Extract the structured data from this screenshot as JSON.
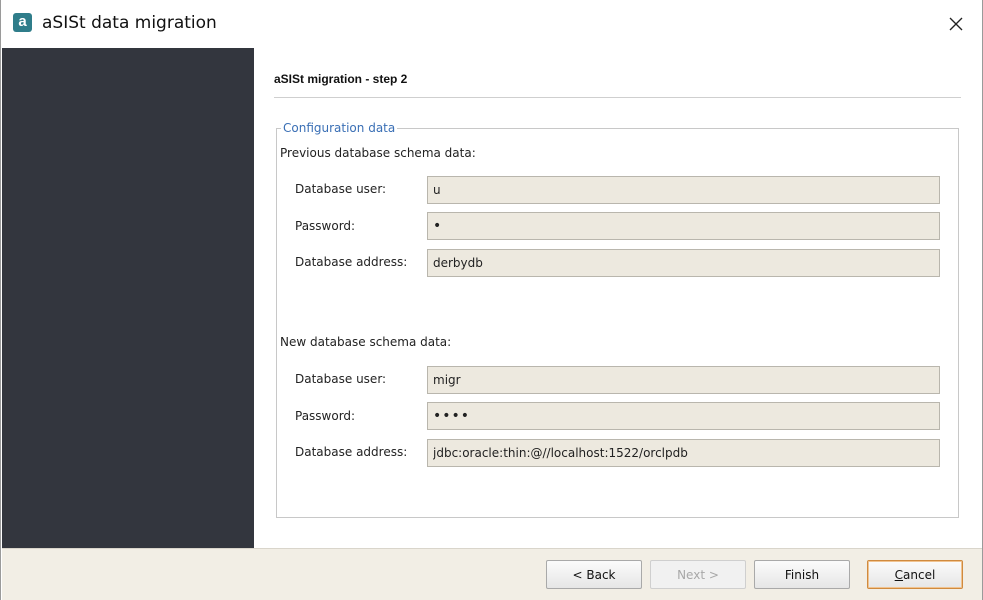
{
  "window": {
    "title": "aSISt data migration",
    "app_icon_letter": "a",
    "close_glyph": "✕"
  },
  "wizard": {
    "step_title": "aSISt migration - step 2"
  },
  "config": {
    "legend": "Configuration data",
    "previous": {
      "heading": "Previous database schema data:",
      "user_label": "Database user:",
      "user_value": "u",
      "password_label": "Password:",
      "password_value": "•",
      "address_label": "Database address:",
      "address_value": "derbydb"
    },
    "new": {
      "heading": "New database schema data:",
      "user_label": "Database user:",
      "user_value": "migr",
      "password_label": "Password:",
      "password_value": "••••",
      "address_label": "Database address:",
      "address_value": "jdbc:oracle:thin:@//localhost:1522/orclpdb"
    }
  },
  "footer": {
    "back_label": "< Back",
    "next_label": "Next >",
    "finish_label": "Finish",
    "cancel_label_underlined": "C",
    "cancel_label_rest": "ancel"
  },
  "colors": {
    "side_panel": "#33363e",
    "input_bg": "#ede9df",
    "legend": "#3a6fb5",
    "footer_bg": "#f2eee5",
    "app_icon": "#2f7d8a"
  }
}
